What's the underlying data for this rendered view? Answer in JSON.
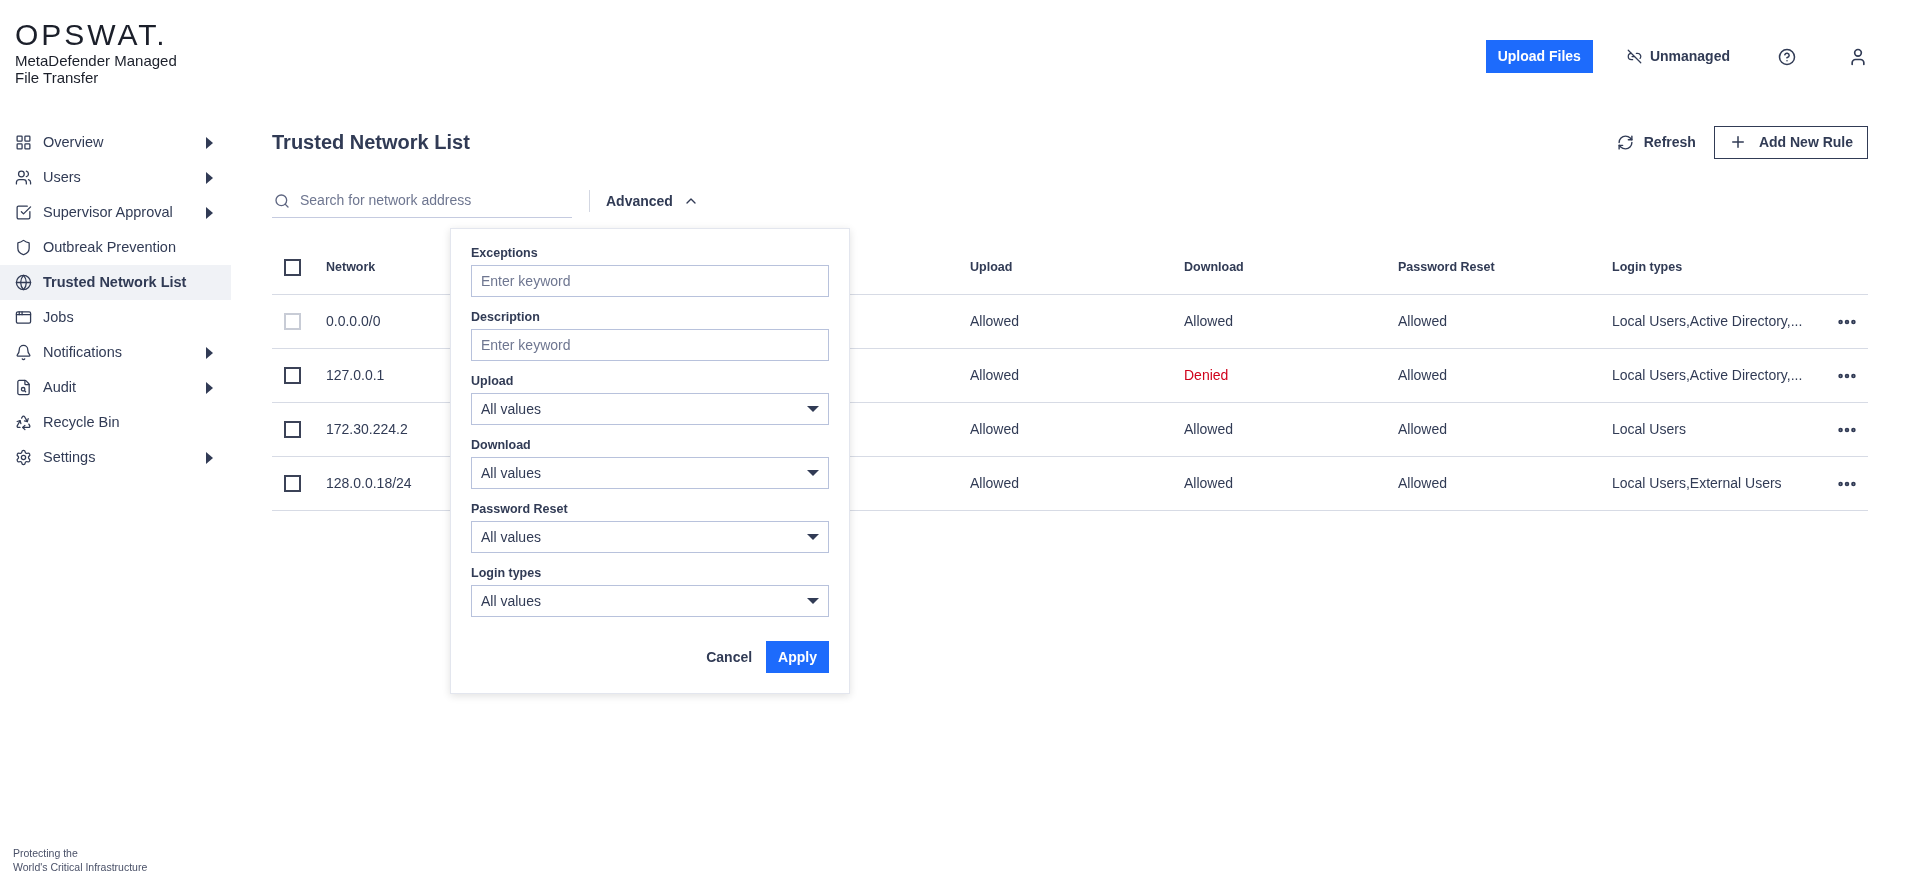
{
  "brand": {
    "logo": "OPSWAT.",
    "product": "MetaDefender Managed File Transfer"
  },
  "header": {
    "upload_button": "Upload Files",
    "mode": "Unmanaged"
  },
  "sidebar": {
    "items": [
      {
        "label": "Overview",
        "expandable": true,
        "selected": false
      },
      {
        "label": "Users",
        "expandable": true,
        "selected": false
      },
      {
        "label": "Supervisor Approval",
        "expandable": true,
        "selected": false
      },
      {
        "label": "Outbreak Prevention",
        "expandable": false,
        "selected": false
      },
      {
        "label": "Trusted Network List",
        "expandable": false,
        "selected": true
      },
      {
        "label": "Jobs",
        "expandable": false,
        "selected": false
      },
      {
        "label": "Notifications",
        "expandable": true,
        "selected": false
      },
      {
        "label": "Audit",
        "expandable": true,
        "selected": false
      },
      {
        "label": "Recycle Bin",
        "expandable": false,
        "selected": false
      },
      {
        "label": "Settings",
        "expandable": true,
        "selected": false
      }
    ],
    "footer": "Protecting the\nWorld's Critical Infrastructure"
  },
  "page": {
    "title": "Trusted Network List",
    "refresh": "Refresh",
    "add_button": "Add New Rule"
  },
  "search": {
    "placeholder": "Search for network address"
  },
  "advanced": {
    "label": "Advanced",
    "expanded": true
  },
  "filter_panel": {
    "fields": [
      {
        "label": "Exceptions",
        "kind": "text",
        "placeholder": "Enter keyword"
      },
      {
        "label": "Description",
        "kind": "text",
        "placeholder": "Enter keyword"
      },
      {
        "label": "Upload",
        "kind": "select",
        "value": "All values"
      },
      {
        "label": "Download",
        "kind": "select",
        "value": "All values"
      },
      {
        "label": "Password Reset",
        "kind": "select",
        "value": "All values"
      },
      {
        "label": "Login types",
        "kind": "select",
        "value": "All values"
      }
    ],
    "cancel": "Cancel",
    "apply": "Apply"
  },
  "table": {
    "select_all_checked": false,
    "columns": [
      "Network",
      "Upload",
      "Download",
      "Password Reset",
      "Login types"
    ],
    "rows": [
      {
        "checked": false,
        "disabled": true,
        "network": "0.0.0.0/0",
        "upload": {
          "text": "Allowed",
          "denied": false
        },
        "download": {
          "text": "Allowed",
          "denied": false
        },
        "password_reset": {
          "text": "Allowed",
          "denied": false
        },
        "login_types": "Local Users,Active Directory,..."
      },
      {
        "checked": false,
        "disabled": false,
        "network": "127.0.0.1",
        "upload": {
          "text": "Allowed",
          "denied": false
        },
        "download": {
          "text": "Denied",
          "denied": true
        },
        "password_reset": {
          "text": "Allowed",
          "denied": false
        },
        "login_types": "Local Users,Active Directory,..."
      },
      {
        "checked": false,
        "disabled": false,
        "network": "172.30.224.2",
        "upload": {
          "text": "Allowed",
          "denied": false
        },
        "download": {
          "text": "Allowed",
          "denied": false
        },
        "password_reset": {
          "text": "Allowed",
          "denied": false
        },
        "login_types": "Local Users"
      },
      {
        "checked": false,
        "disabled": false,
        "network": "128.0.0.18/24",
        "upload": {
          "text": "Allowed",
          "denied": false
        },
        "download": {
          "text": "Allowed",
          "denied": false
        },
        "password_reset": {
          "text": "Allowed",
          "denied": false
        },
        "login_types": "Local Users,External Users"
      }
    ]
  }
}
